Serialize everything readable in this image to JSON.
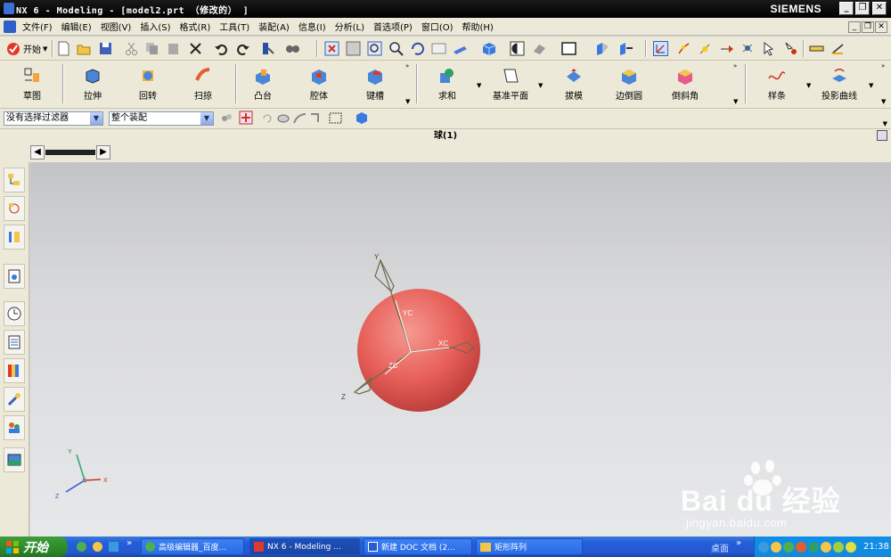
{
  "window": {
    "title": "NX 6 - Modeling - [model2.prt （修改的） ]",
    "brand": "SIEMENS"
  },
  "menubar": {
    "items": [
      "文件(F)",
      "编辑(E)",
      "视图(V)",
      "插入(S)",
      "格式(R)",
      "工具(T)",
      "装配(A)",
      "信息(I)",
      "分析(L)",
      "首选项(P)",
      "窗口(O)",
      "帮助(H)"
    ]
  },
  "toolbar_standard": {
    "start_label": "开始",
    "icons": [
      "new-icon",
      "open-icon",
      "save-icon",
      "cut-icon",
      "copy-icon",
      "paste-icon",
      "delete-icon",
      "undo-icon",
      "redo-icon",
      "info-icon",
      "view-icon",
      "fit-icon",
      "zoom-icon",
      "rotate-icon",
      "shaded-icon",
      "render-style-icon",
      "background-icon",
      "wcs-icon",
      "snap-icon",
      "measure-icon"
    ]
  },
  "toolbar_features": {
    "buttons": [
      "草图",
      "拉伸",
      "回转",
      "扫掠",
      "凸台",
      "腔体",
      "键槽",
      "求和",
      "基准平面",
      "拔模",
      "边倒圆",
      "倒斜角",
      "样条",
      "投影曲线"
    ]
  },
  "selection_bar": {
    "type_filter": "没有选择过滤器",
    "scope": "整个装配"
  },
  "graphics": {
    "part_title": "球(1)",
    "csys_labels": {
      "y": "Y",
      "z": "Z",
      "yc": "YC",
      "xc": "XC",
      "zc": "ZC"
    },
    "triad_labels": {
      "x": "X",
      "y": "Y",
      "z": "Z"
    },
    "sphere_color": "#e8605a"
  },
  "taskbar": {
    "start_label": "开始",
    "tasks": [
      "高级编辑器_百度...",
      "NX 6 - Modeling ...",
      "新建 DOC 文档 (2...",
      "矩形阵列"
    ],
    "desktop_label": "桌面",
    "clock": "21:38"
  },
  "watermark": {
    "brand": "Bai du 经验",
    "url": "jingyan.baidu.com"
  }
}
